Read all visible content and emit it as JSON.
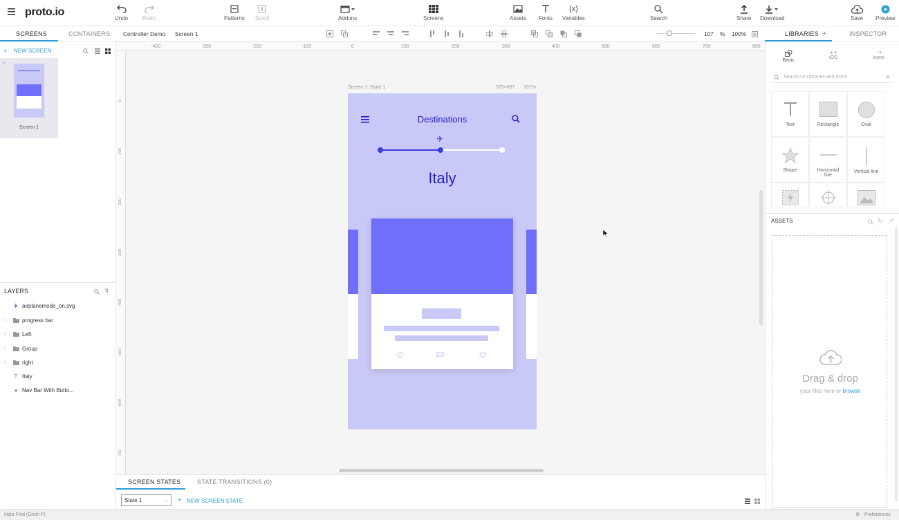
{
  "app": {
    "logo": "proto.io"
  },
  "toolbar": {
    "undo": "Undo",
    "redo": "Redo",
    "patterns": "Patterns",
    "scroll": "Scroll",
    "addons": "Addons",
    "screens": "Screens",
    "assets": "Assets",
    "fonts": "Fonts",
    "variables": "Variables",
    "variables_glyph": "(x)",
    "search": "Search",
    "share": "Share",
    "download": "Download",
    "save": "Save",
    "preview": "Preview"
  },
  "subbar": {
    "tab_screens": "SCREENS",
    "tab_containers": "CONTAINERS",
    "breadcrumb_project": "Controller Demo",
    "breadcrumb_screen": "Screen 1",
    "zoom_value": "107",
    "zoom_unit": "%",
    "zoom_fit": "100%",
    "tab_libraries": "LIBRARIES",
    "tab_inspector": "INSPECTOR"
  },
  "left": {
    "new_screen": "NEW SCREEN",
    "screen_thumb_label": "Screen 1",
    "layers_title": "LAYERS",
    "layers": [
      {
        "name": "airplanemode_on.svg"
      },
      {
        "name": "progress bar"
      },
      {
        "name": "Left"
      },
      {
        "name": "Group"
      },
      {
        "name": "right"
      },
      {
        "name": "Italy"
      },
      {
        "name": "Nav Bar With Butto..."
      }
    ]
  },
  "canvas": {
    "ruler_marks": [
      "-400",
      "-300",
      "-200",
      "-100",
      "0",
      "100",
      "200",
      "300",
      "400",
      "500",
      "600",
      "700",
      "800"
    ],
    "ruler_marks_v": [
      "0",
      "100",
      "200",
      "300",
      "400",
      "500",
      "600",
      "700",
      "800"
    ],
    "artboard_label": "Screen 1: State 1",
    "artboard_size": "375×667",
    "artboard_zoom": "107%",
    "title": "Destinations",
    "heading": "Italy"
  },
  "bottom": {
    "tab_states": "SCREEN STATES",
    "tab_transitions": "STATE TRANSITIONS (0)",
    "state_value": "State 1",
    "new_state": "NEW SCREEN STATE"
  },
  "right": {
    "lib_basic": "Basic",
    "lib_ios": "iOS",
    "lib_icons": "Icons",
    "search_placeholder": "Search UI Libraries and icons",
    "items": [
      {
        "label": "Text"
      },
      {
        "label": "Rectangle"
      },
      {
        "label": "Oval"
      },
      {
        "label": "Shape"
      },
      {
        "label": "Horizontal line"
      },
      {
        "label": "Vertical line"
      }
    ],
    "assets_title": "ASSETS",
    "drag_title": "Drag & drop",
    "drag_sub_pre": "your files here or",
    "drag_sub_link": "browse"
  },
  "status": {
    "left_text": "Halo  Find (Cmd+F)",
    "right_text": "Preferences"
  },
  "colors": {
    "accent": "#2b9ed8",
    "artboard": "#c9c9f7",
    "brand_blue": "#1f1fcc",
    "card_image": "#6f6ffb"
  }
}
